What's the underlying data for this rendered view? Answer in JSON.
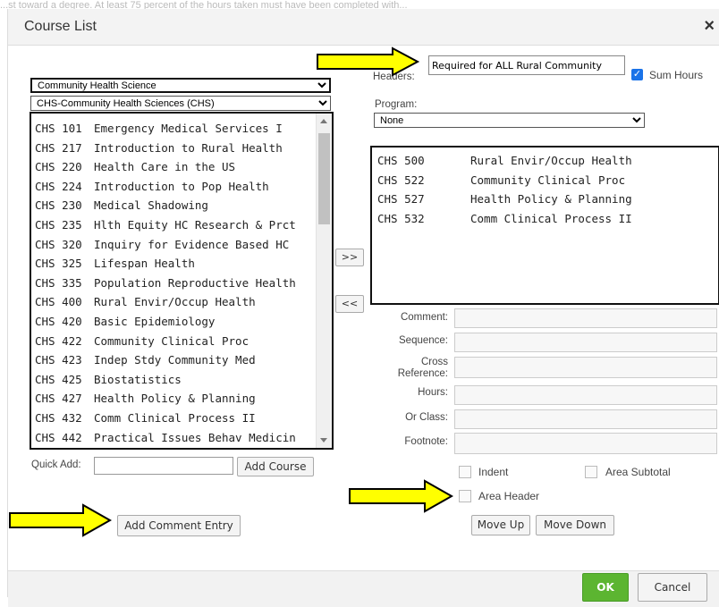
{
  "background_text": "...st toward a degree. At least 75 percent of the hours taken must have been completed with...",
  "dialog": {
    "title": "Course List",
    "close": "×"
  },
  "left": {
    "department": "Community Health Science",
    "subject": "CHS-Community Health Sciences (CHS)",
    "courses": [
      {
        "code": "CHS 101",
        "name": "Emergency Medical Services I"
      },
      {
        "code": "CHS 217",
        "name": "Introduction to Rural Health"
      },
      {
        "code": "CHS 220",
        "name": "Health Care in the US"
      },
      {
        "code": "CHS 224",
        "name": "Introduction to Pop Health"
      },
      {
        "code": "CHS 230",
        "name": "Medical Shadowing"
      },
      {
        "code": "CHS 235",
        "name": "Hlth Equity HC Research & Prct"
      },
      {
        "code": "CHS 320",
        "name": "Inquiry for Evidence Based HC"
      },
      {
        "code": "CHS 325",
        "name": "Lifespan Health"
      },
      {
        "code": "CHS 335",
        "name": "Population Reproductive Health"
      },
      {
        "code": "CHS 400",
        "name": "Rural Envir/Occup Health"
      },
      {
        "code": "CHS 420",
        "name": "Basic Epidemiology"
      },
      {
        "code": "CHS 422",
        "name": "Community Clinical Proc"
      },
      {
        "code": "CHS 423",
        "name": "Indep Stdy Community Med"
      },
      {
        "code": "CHS 425",
        "name": "Biostatistics"
      },
      {
        "code": "CHS 427",
        "name": "Health Policy & Planning"
      },
      {
        "code": "CHS 432",
        "name": "Comm Clinical Process II"
      },
      {
        "code": "CHS 442",
        "name": "Practical Issues Behav Medicin"
      }
    ],
    "quick_add_label": "Quick Add:",
    "quick_add_value": "",
    "add_course": "Add Course",
    "add_comment_entry": "Add Comment Entry"
  },
  "middle": {
    "add": ">>",
    "remove": "<<"
  },
  "right": {
    "headers_label": "Headers:",
    "headers_value": "Required for ALL Rural Community",
    "sum_hours": "Sum Hours",
    "sum_hours_checked": true,
    "program_label": "Program:",
    "program_value": "None",
    "selected_courses": [
      {
        "code": "CHS 500",
        "name": "Rural Envir/Occup Health"
      },
      {
        "code": "CHS 522",
        "name": "Community Clinical Proc"
      },
      {
        "code": "CHS 527",
        "name": "Health Policy & Planning"
      },
      {
        "code": "CHS 532",
        "name": "Comm Clinical Process II"
      }
    ],
    "comment_label": "Comment:",
    "sequence_label": "Sequence:",
    "cross_reference_label_1": "Cross",
    "cross_reference_label_2": "Reference:",
    "hours_label": "Hours:",
    "or_class_label": "Or Class:",
    "footnote_label": "Footnote:",
    "indent": "Indent",
    "area_subtotal": "Area Subtotal",
    "area_header": "Area Header",
    "move_up": "Move Up",
    "move_down": "Move Down"
  },
  "footer": {
    "ok": "OK",
    "cancel": "Cancel"
  },
  "colors": {
    "ok_green": "#5cb531",
    "arrow_yellow": "#ffff00",
    "checkbox_blue": "#1a73e8"
  }
}
